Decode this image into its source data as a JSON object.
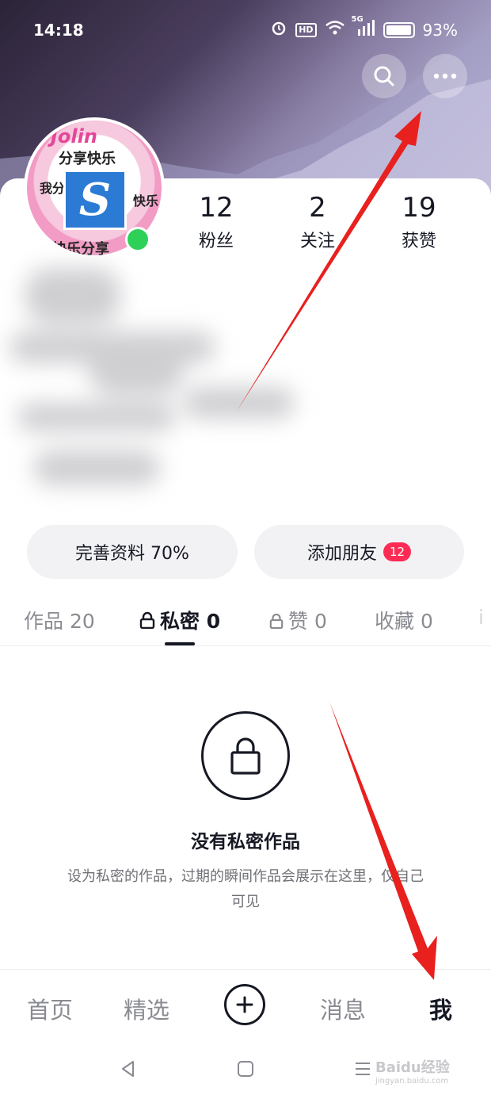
{
  "status_bar": {
    "time": "14:18",
    "hd": "HD",
    "network": "5G",
    "battery": "93%"
  },
  "profile": {
    "avatar_brand": "Jolin",
    "avatar_texts": [
      "分享快乐",
      "我分",
      "快乐",
      "快乐分享"
    ],
    "avatar_logo": "S",
    "stats": [
      {
        "value": "12",
        "label": "粉丝"
      },
      {
        "value": "2",
        "label": "关注"
      },
      {
        "value": "19",
        "label": "获赞"
      }
    ]
  },
  "actions": {
    "complete_profile": "完善资料 70%",
    "add_friends": "添加朋友",
    "add_friends_badge": "12"
  },
  "tabs": [
    {
      "label": "作品 20"
    },
    {
      "label": "私密 0"
    },
    {
      "label": "赞 0"
    },
    {
      "label": "收藏 0"
    },
    {
      "label": "i"
    }
  ],
  "empty_state": {
    "title": "没有私密作品",
    "description": "设为私密的作品，过期的瞬间作品会展示在这里，仅自己可见"
  },
  "bottom_nav": {
    "home": "首页",
    "featured": "精选",
    "messages": "消息",
    "me": "我"
  },
  "watermark": {
    "brand": "Baidu经验",
    "url": "jingyan.baidu.com"
  },
  "colors": {
    "accent": "#fe2c55",
    "online": "#2ed158",
    "annotation_arrow": "#e8201e"
  }
}
